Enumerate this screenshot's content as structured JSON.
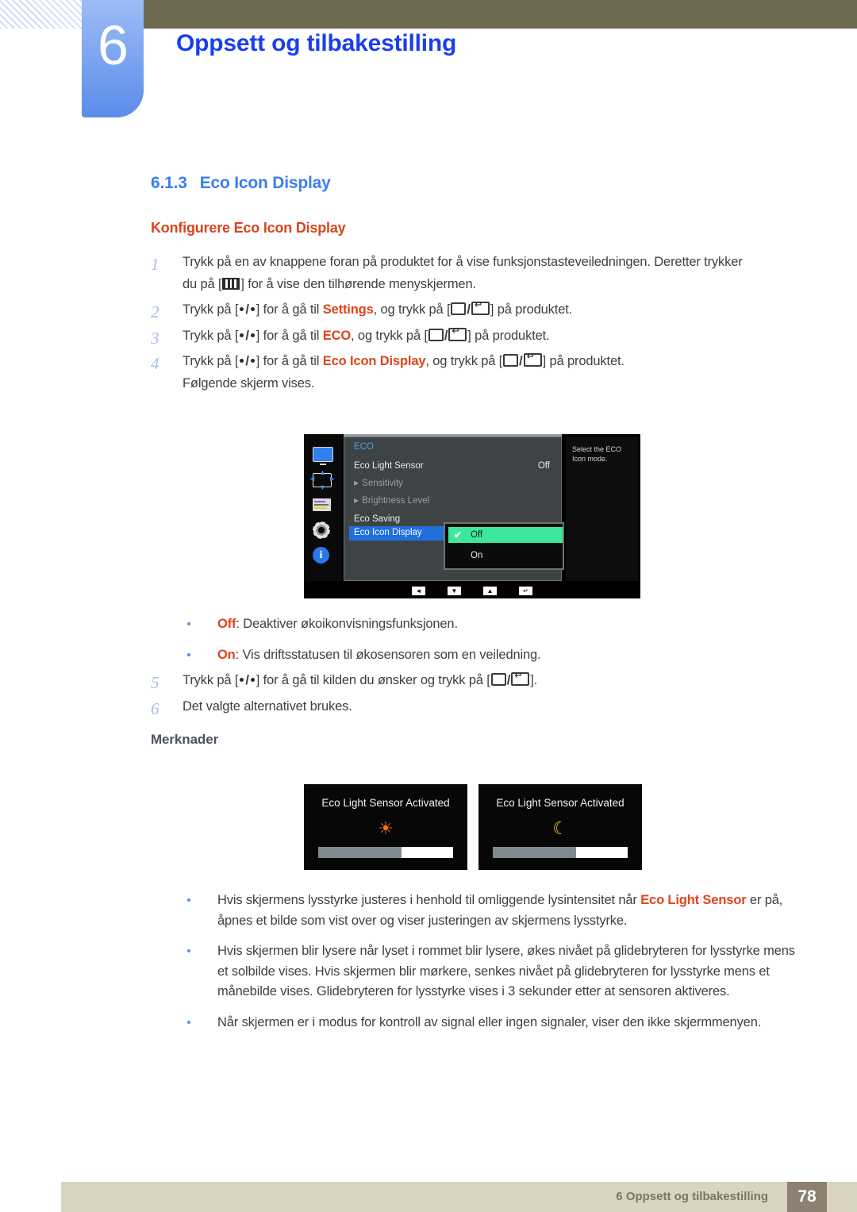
{
  "header": {
    "chapter_number": "6",
    "chapter_title": "Oppsett og tilbakestilling",
    "accent_blue": "#1a3ff0",
    "tab_blue": "#7fa7f2",
    "olive": "#6e6a52"
  },
  "section": {
    "number": "6.1.3",
    "title": "Eco Icon Display",
    "subtitle": "Konfigurere Eco Icon Display",
    "heading_color": "#3a7ef5",
    "subtitle_color": "#d9441f"
  },
  "steps": [
    {
      "marker": "1",
      "text_a": "Trykk på en av knappene foran på produktet for å vise funksjonstasteveiledningen. Deretter trykker",
      "text_b_pre": "du på [",
      "text_b_post": "] for å vise den tilhørende menyskjermen."
    },
    {
      "marker": "2",
      "pre": "Trykk på [",
      "mid": "] for å gå til ",
      "keyword": "Settings",
      "mid2": ", og trykk på [",
      "post": "] på produktet."
    },
    {
      "marker": "3",
      "pre": "Trykk på [",
      "mid": "] for å gå til ",
      "keyword": "ECO",
      "mid2": ", og trykk på [",
      "post": "] på produktet."
    },
    {
      "marker": "4",
      "pre": "Trykk på [",
      "mid": "] for å gå til ",
      "keyword": "Eco Icon Display",
      "mid2": ", og trykk på [",
      "post": "] på produktet.",
      "continuation": "Følgende skjerm vises."
    },
    {
      "marker": "5",
      "pre": "Trykk på [",
      "mid": "] for å gå til kilden du ønsker og trykk på [",
      "post": "]."
    },
    {
      "marker": "6",
      "text_a": "Det valgte alternativet brukes."
    }
  ],
  "osd": {
    "menu_title": "ECO",
    "rows": [
      {
        "label": "Eco Light Sensor",
        "value": "Off",
        "dim": false,
        "arrow": false
      },
      {
        "label": "Sensitivity",
        "value": "",
        "dim": true,
        "arrow": true
      },
      {
        "label": "Brightness Level",
        "value": "",
        "dim": true,
        "arrow": true
      },
      {
        "label": "Eco Saving",
        "value": "",
        "dim": false,
        "arrow": false
      }
    ],
    "highlighted_row": "Eco Icon Display",
    "dropdown": {
      "selected": "Off",
      "options": [
        "Off",
        "On"
      ],
      "checkmark": "✔",
      "highlight_color": "#3ee89a"
    },
    "help_text": "Select the ECO Icon mode.",
    "footer_buttons": [
      "◄",
      "▼",
      "▲",
      "↵"
    ],
    "sidebar_icons": [
      "monitor-icon",
      "resize-arrows-icon",
      "menu-list-icon",
      "gear-icon",
      "info-icon"
    ]
  },
  "option_bullets": [
    {
      "keyword": "Off",
      "text": ": Deaktiver økoikonvisningsfunksjonen."
    },
    {
      "keyword": "On",
      "text": ": Vis driftsstatusen til økosensoren som en veiledning."
    }
  ],
  "notes_heading": "Merknader",
  "note_images": [
    {
      "caption": "Eco Light Sensor Activated",
      "symbol": "☀",
      "symbol_name": "sun-icon",
      "fill_percent": 62
    },
    {
      "caption": "Eco Light Sensor Activated",
      "symbol": "☾",
      "symbol_name": "moon-icon",
      "fill_percent": 62
    }
  ],
  "note_bullets": [
    {
      "pre": "Hvis skjermens lysstyrke justeres i henhold til omliggende lysintensitet når ",
      "keyword": "Eco Light Sensor",
      "post": " er på, åpnes et bilde som vist over og viser justeringen av skjermens lysstyrke."
    },
    {
      "pre": "Hvis skjermen blir lysere når lyset i rommet blir lysere, økes nivået på glidebryteren for lysstyrke mens et solbilde vises. Hvis skjermen blir mørkere, senkes nivået på glidebryteren for lysstyrke mens et månebilde vises. Glidebryteren for lysstyrke vises i 3 sekunder etter at sensoren aktiveres.",
      "keyword": "",
      "post": ""
    },
    {
      "pre": "Når skjermen er i modus for kontroll av signal eller ingen signaler, viser den ikke skjermmenyen.",
      "keyword": "",
      "post": ""
    }
  ],
  "footer": {
    "text": "6 Oppsett og tilbakestilling",
    "page_number": "78",
    "bar_color": "#d9d4c0",
    "page_box_color": "#8c8072"
  }
}
